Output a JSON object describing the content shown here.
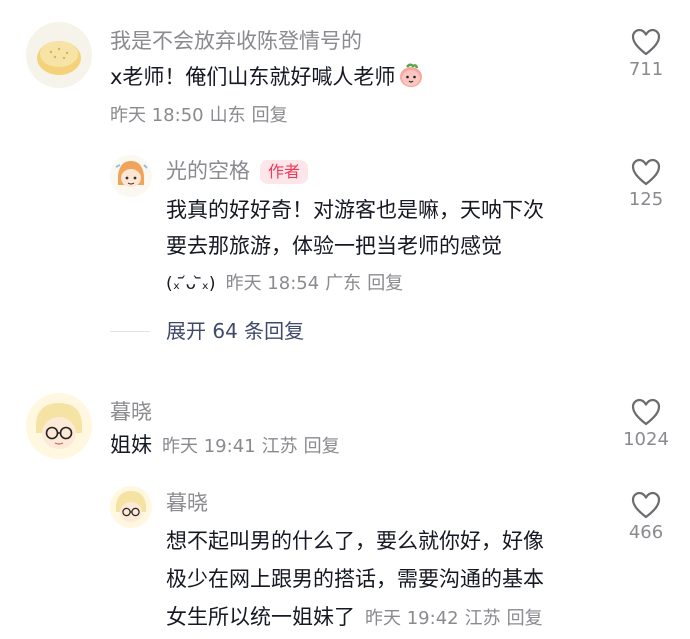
{
  "comments": [
    {
      "user": "我是不会放弃收陈登情号的",
      "text_lines": [
        "x老师！俺们山东就好喊人老师"
      ],
      "emoji": "peach-emoji",
      "time": "昨天 18:50",
      "location": "山东",
      "reply_label": "回复",
      "likes": "711",
      "replies": [
        {
          "user": "光的空格",
          "badge": "作者",
          "text_lines": [
            "我真的好好奇！对游客也是嘛，天呐下次",
            "要去那旅游，体验一把当老师的感觉"
          ],
          "kaomoji": "(ₓ ᷄ᴗ ᷅ₓ)",
          "time": "昨天 18:54",
          "location": "广东",
          "reply_label": "回复",
          "likes": "125"
        }
      ],
      "expand_label": "展开 64 条回复"
    },
    {
      "user": "暮晓",
      "text": "姐妹",
      "time": "昨天 19:41",
      "location": "江苏",
      "reply_label": "回复",
      "likes": "1024",
      "replies": [
        {
          "user": "暮晓",
          "text_lines": [
            "想不起叫男的什么了，要么就你好，好像",
            "极少在网上跟男的搭话，需要沟通的基本",
            "女生所以统一姐妹了"
          ],
          "time": "昨天 19:42",
          "location": "江苏",
          "reply_label": "回复",
          "likes": "466"
        }
      ]
    }
  ],
  "colors": {
    "primary_text": "#161823",
    "secondary_text": "#8a8a8f",
    "author_badge_bg": "#fde6ea",
    "author_badge_text": "#f1395a",
    "expand_text": "#3f4a6b"
  }
}
